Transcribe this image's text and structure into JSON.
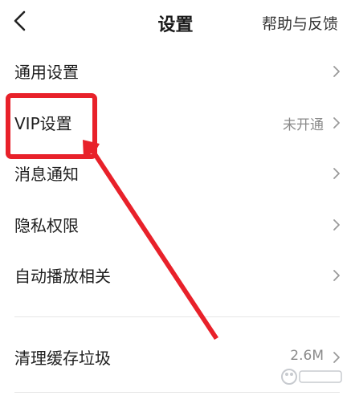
{
  "header": {
    "title": "设置",
    "help_label": "帮助与反馈"
  },
  "settings": {
    "items": [
      {
        "label": "通用设置",
        "value": ""
      },
      {
        "label": "VIP设置",
        "value": "未开通"
      },
      {
        "label": "消息通知",
        "value": ""
      },
      {
        "label": "隐私权限",
        "value": ""
      },
      {
        "label": "自动播放相关",
        "value": ""
      },
      {
        "label": "清理缓存垃圾",
        "value": "2.6M"
      }
    ]
  },
  "colors": {
    "annotation_red": "#e8212a",
    "text_primary": "#1e1e1e",
    "text_secondary": "#8a8a8a",
    "chevron": "#9a9a9a",
    "divider": "#e6e6e6"
  },
  "icons": {
    "back": "chevron-left-icon",
    "row_arrow": "chevron-right-icon",
    "watermark": "baidu-watermark-icon"
  }
}
